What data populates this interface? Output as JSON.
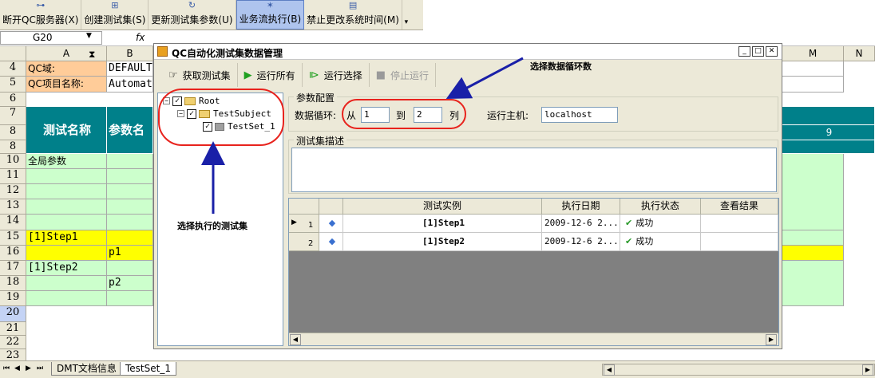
{
  "toolbar": {
    "buttons": [
      {
        "label": "断开QC服务器(X)"
      },
      {
        "label": "创建测试集(S)"
      },
      {
        "label": "更新测试集参数(U)"
      },
      {
        "label": "业务流执行(B)"
      },
      {
        "label": "禁止更改系统时间(M)"
      }
    ]
  },
  "formula": {
    "cell_ref": "G20",
    "fx": "fx"
  },
  "sheet": {
    "columns": [
      "A",
      "B",
      "M",
      "N"
    ],
    "rows": [
      "4",
      "5",
      "6",
      "7",
      "8",
      "8",
      "10",
      "11",
      "12",
      "13",
      "14",
      "15",
      "16",
      "17",
      "18",
      "19",
      "20",
      "21",
      "22",
      "23"
    ],
    "cells": {
      "qc_domain_label": "QC域:",
      "qc_domain_value": "DEFAULT",
      "qc_project_label": "QC项目名称:",
      "qc_project_value": "Automat",
      "header_test_name": "测试名称",
      "header_param_name": "参数名",
      "header_col9": "9",
      "global_params": "全局参数",
      "step1": "[1]Step1",
      "p1": "p1",
      "step2": "[1]Step2",
      "p2": "p2"
    }
  },
  "dialog": {
    "title": "QC自动化测试集数据管理",
    "toolbar": {
      "get_testset": "获取测试集",
      "run_all": "运行所有",
      "run_selected": "运行选择",
      "stop_run": "停止运行"
    },
    "tree": {
      "root": "Root",
      "subject": "TestSubject",
      "testset": "TestSet_1"
    },
    "params": {
      "legend": "参数配置",
      "loop_label": "数据循环:",
      "from_label": "从",
      "from_value": "1",
      "to_label": "到",
      "to_value": "2",
      "col_label": "列",
      "host_label": "运行主机:",
      "host_value": "localhost"
    },
    "desc": {
      "legend": "测试集描述"
    },
    "grid": {
      "headers": [
        "测试实例",
        "执行日期",
        "执行状态",
        "查看结果"
      ],
      "rows": [
        {
          "num": "1",
          "instance": "[1]Step1",
          "date": "2009-12-6 2...",
          "status": "成功"
        },
        {
          "num": "2",
          "instance": "[1]Step2",
          "date": "2009-12-6 2...",
          "status": "成功"
        }
      ]
    }
  },
  "annotations": {
    "select_testset": "选择执行的测试集",
    "select_loop": "选择数据循环数"
  },
  "tabs": [
    {
      "label": "DMT文档信息"
    },
    {
      "label": "TestSet_1"
    }
  ],
  "colors": {
    "teal": "#00808a",
    "light_green": "#ccffcc",
    "yellow": "#ffff00",
    "orange_label": "#ffcc99"
  }
}
